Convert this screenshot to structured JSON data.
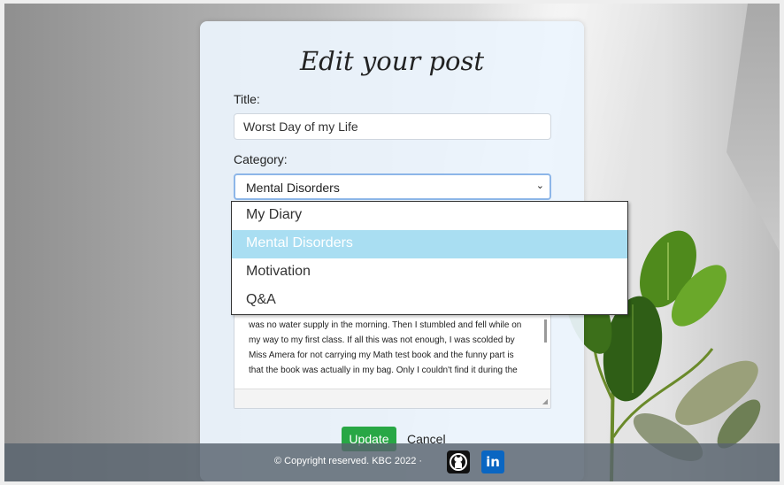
{
  "form": {
    "heading": "Edit your post",
    "title_label": "Title:",
    "title_value": "Worst Day of my Life",
    "category_label": "Category:",
    "category_selected": "Mental Disorders",
    "category_options": [
      "My Diary",
      "Mental Disorders",
      "Motivation",
      "Q&A"
    ],
    "content_lines": [
      "was no water supply in the morning. Then I stumbled and fell while on",
      "my way to my first class. If all this was not enough, I was scolded by",
      "Miss Amera for not carrying my Math test book and the funny part is",
      "that the book was actually in my bag. Only I couldn't find it during the"
    ],
    "update_label": "Update",
    "cancel_label": "Cancel"
  },
  "footer": {
    "copyright": "© Copyright reserved. KBC 2022 ·"
  },
  "colors": {
    "update_button": "#28a745",
    "dropdown_highlight": "#a9def2",
    "linkedin": "#0a66c2"
  },
  "icons": [
    "chevron-down-icon",
    "github-icon",
    "linkedin-icon",
    "resize-handle-icon"
  ]
}
